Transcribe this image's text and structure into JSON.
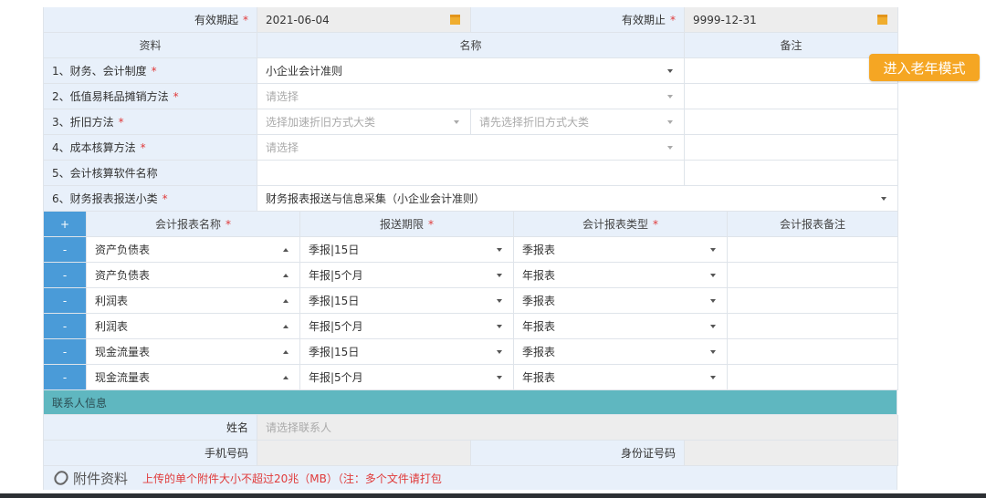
{
  "validity": {
    "start_label": "有效期起",
    "start_value": "2021-06-04",
    "end_label": "有效期止",
    "end_value": "9999-12-31",
    "required_mark": "*"
  },
  "info_table": {
    "headers": {
      "material": "资料",
      "name": "名称",
      "remark": "备注"
    },
    "rows": [
      {
        "label": "1、财务、会计制度",
        "value": "小企业会计准则"
      },
      {
        "label": "2、低值易耗品摊销方法",
        "placeholder": "请选择"
      },
      {
        "label": "3、折旧方法",
        "placeholder1": "选择加速折旧方式大类",
        "placeholder2": "请先选择折旧方式大类"
      },
      {
        "label": "4、成本核算方法",
        "placeholder": "请选择"
      },
      {
        "label": "5、会计核算软件名称"
      },
      {
        "label": "6、财务报表报送小类",
        "value": "财务报表报送与信息采集（小企业会计准则）"
      }
    ]
  },
  "report_table": {
    "add_label": "+",
    "remove_label": "-",
    "headers": {
      "name": "会计报表名称",
      "period": "报送期限",
      "type": "会计报表类型",
      "remark": "会计报表备注"
    },
    "rows": [
      {
        "name": "资产负债表",
        "period": "季报|15日",
        "type": "季报表"
      },
      {
        "name": "资产负债表",
        "period": "年报|5个月",
        "type": "年报表"
      },
      {
        "name": "利润表",
        "period": "季报|15日",
        "type": "季报表"
      },
      {
        "name": "利润表",
        "period": "年报|5个月",
        "type": "年报表"
      },
      {
        "name": "现金流量表",
        "period": "季报|15日",
        "type": "季报表"
      },
      {
        "name": "现金流量表",
        "period": "年报|5个月",
        "type": "年报表"
      }
    ]
  },
  "contact": {
    "section_title": "联系人信息",
    "name_label": "姓名",
    "name_placeholder": "请选择联系人",
    "phone_label": "手机号码",
    "id_label": "身份证号码"
  },
  "attachment": {
    "title": "附件资料",
    "note": "上传的单个附件大小不超过20兆（MB）（注：多个文件请打包"
  },
  "elder_mode_button": "进入老年模式"
}
